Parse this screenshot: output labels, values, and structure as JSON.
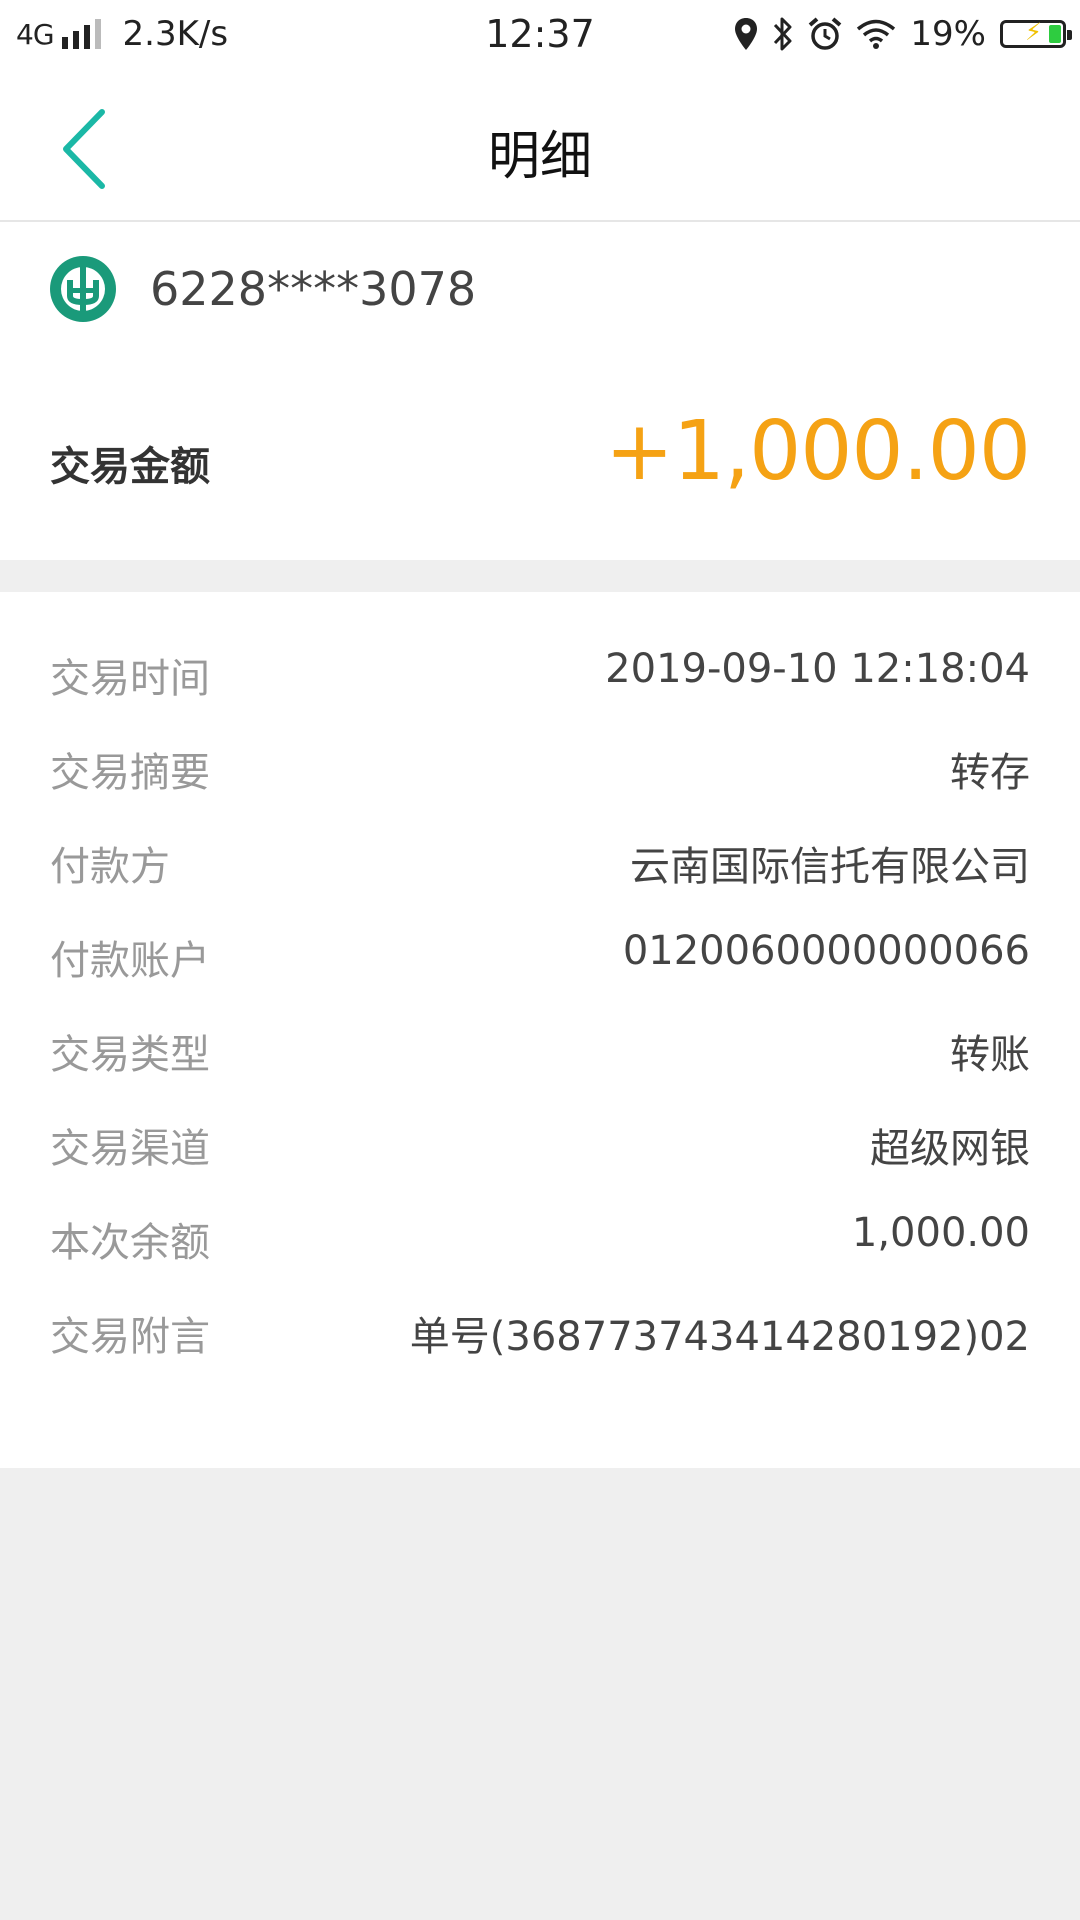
{
  "status_bar": {
    "network": "4G",
    "speed": "2.3K/s",
    "time": "12:37",
    "battery": "19%",
    "icons": [
      "location-icon",
      "bluetooth-icon",
      "alarm-icon",
      "wifi-icon",
      "battery-icon"
    ]
  },
  "nav": {
    "title": "明细",
    "back_icon": "chevron-left-icon",
    "accent_color": "#1bb8a6"
  },
  "account": {
    "bank_logo_icon": "abc-bank-logo",
    "bank_logo_color": "#1a9a7a",
    "card_number": "6228****3078",
    "amount_label": "交易金额",
    "amount_value": "+1,000.00",
    "amount_color": "#f5a214"
  },
  "details": [
    {
      "label": "交易时间",
      "value": "2019-09-10 12:18:04"
    },
    {
      "label": "交易摘要",
      "value": "转存"
    },
    {
      "label": "付款方",
      "value": "云南国际信托有限公司"
    },
    {
      "label": "付款账户",
      "value": "0120060000000066"
    },
    {
      "label": "交易类型",
      "value": "转账"
    },
    {
      "label": "交易渠道",
      "value": "超级网银"
    },
    {
      "label": "本次余额",
      "value": "1,000.00"
    },
    {
      "label": "交易附言",
      "value": "单号(36877374341428​0192)02"
    }
  ]
}
